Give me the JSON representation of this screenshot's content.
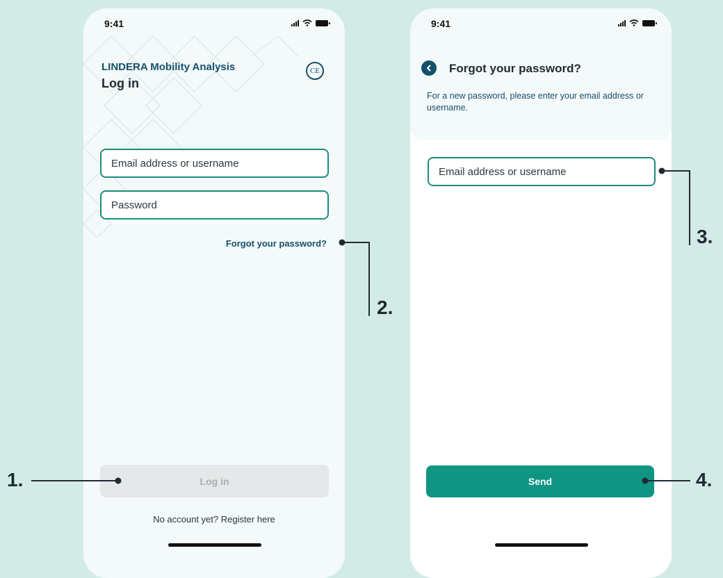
{
  "login_screen": {
    "time": "9:41",
    "brand": "LINDERA Mobility Analysis",
    "title": "Log in",
    "ce_mark": "CE",
    "email_placeholder": "Email address or username",
    "password_placeholder": "Password",
    "forgot_link": "Forgot your password?",
    "login_button": "Log in",
    "register_text": "No account yet? Register here"
  },
  "forgot_screen": {
    "time": "9:41",
    "title": "Forgot your password?",
    "description": "For a new password, please enter your email address or username.",
    "email_placeholder": "Email address or username",
    "send_button": "Send"
  },
  "callouts": [
    "1.",
    "2.",
    "3.",
    "4."
  ],
  "colors": {
    "background": "#d3ebe6",
    "accent": "#0f9582",
    "field_border": "#1b8c7e",
    "brand_text": "#14506b",
    "disabled_button": "#e5e8e8"
  },
  "icons": [
    "signal-icon",
    "wifi-icon",
    "battery-icon",
    "ce-mark-icon",
    "back-chevron-icon"
  ]
}
